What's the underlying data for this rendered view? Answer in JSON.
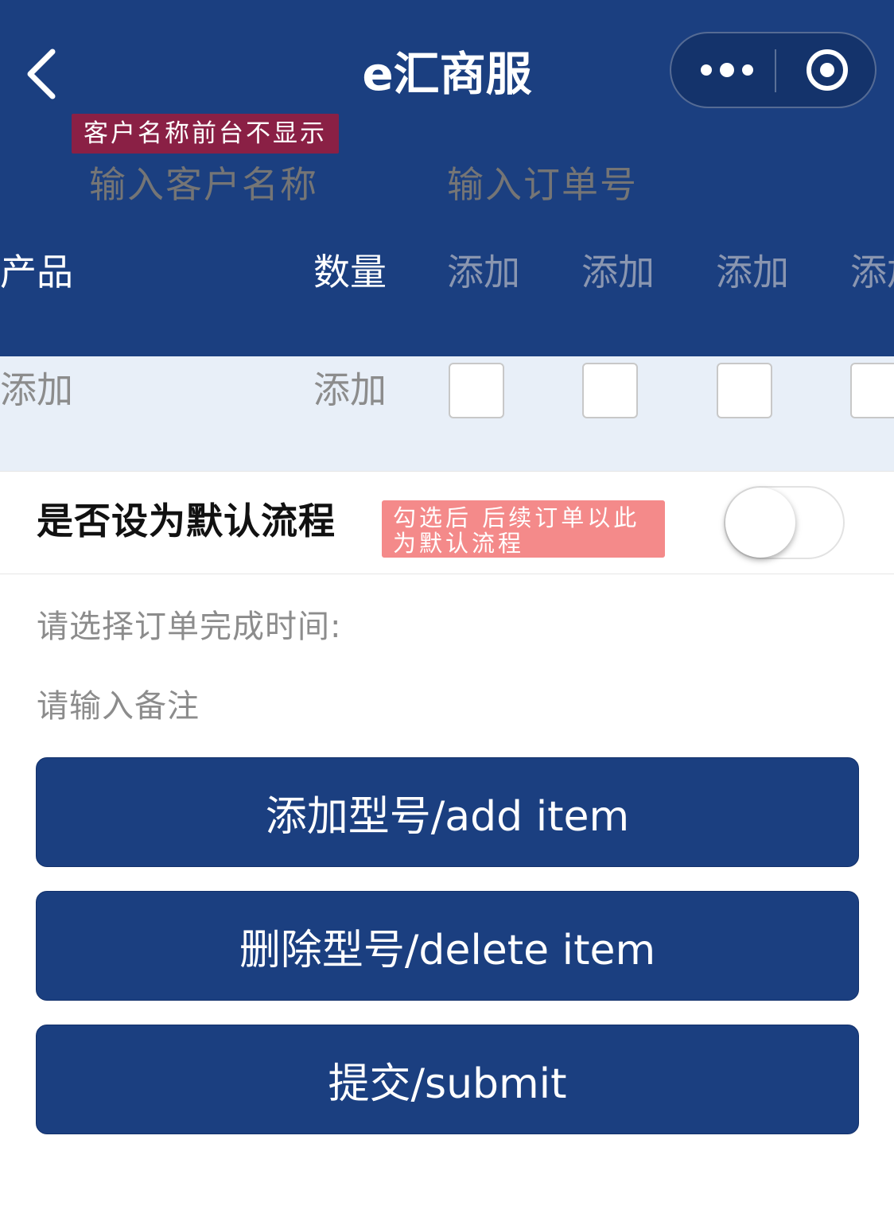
{
  "nav": {
    "title": "e汇商服"
  },
  "form": {
    "customer_name_tip": "客户名称前台不显示",
    "customer_name_placeholder": "输入客户名称",
    "order_no_placeholder": "输入订单号"
  },
  "table": {
    "headers": [
      "产品",
      "数量",
      "添加",
      "添加",
      "添加",
      "添加"
    ],
    "row": {
      "product": "添加",
      "quantity": "添加",
      "checkboxes": [
        false,
        false,
        false,
        false
      ]
    }
  },
  "default_process": {
    "label": "是否设为默认流程",
    "tip": "勾选后 后续订单以此为默认流程",
    "enabled": false
  },
  "completion_time_label": "请选择订单完成时间:",
  "remark_placeholder": "请输入备注",
  "buttons": {
    "add_item": "添加型号/add item",
    "delete_item": "删除型号/delete item",
    "submit": "提交/submit"
  },
  "colors": {
    "primary": "#1b3f80",
    "tip_dark": "#8a2045",
    "tip_light": "#f48a8a",
    "row_bg": "#e8eff8"
  }
}
